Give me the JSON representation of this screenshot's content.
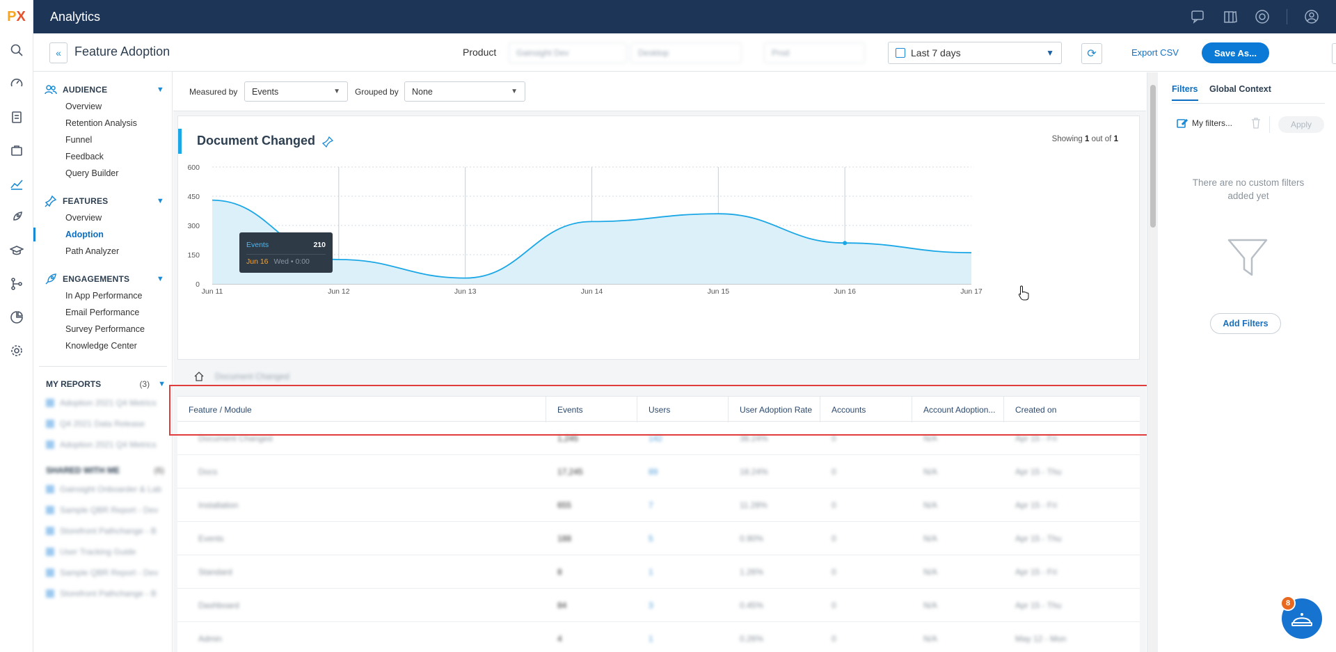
{
  "app": {
    "title": "Analytics",
    "logo": "PX"
  },
  "header": {
    "page_title": "Feature Adoption",
    "product_label": "Product",
    "product_selects": [
      "Gainsight Dev",
      "Desktop",
      "Prod"
    ],
    "date_range": "Last 7 days",
    "export_label": "Export CSV",
    "save_label": "Save As..."
  },
  "sidebar": {
    "sections": [
      {
        "title": "AUDIENCE",
        "icon": "users-icon",
        "items": [
          "Overview",
          "Retention Analysis",
          "Funnel",
          "Feedback",
          "Query Builder"
        ]
      },
      {
        "title": "FEATURES",
        "icon": "pin-icon",
        "items": [
          "Overview",
          "Adoption",
          "Path Analyzer"
        ],
        "active": "Adoption"
      },
      {
        "title": "ENGAGEMENTS",
        "icon": "rocket-icon",
        "items": [
          "In App Performance",
          "Email Performance",
          "Survey Performance",
          "Knowledge Center"
        ]
      }
    ],
    "my_reports": {
      "title": "MY REPORTS",
      "count": "(3)",
      "items": [
        "Adoption 2021 Q4 Metrics",
        "Q4 2021 Data Release",
        "Adoption 2021 Q4 Metrics"
      ]
    },
    "shared": {
      "title": "SHARED WITH ME",
      "count": "(6)",
      "items": [
        "Gainsight Onboarder & Lab",
        "Sample QBR Report - Dev",
        "Storefront Pathchange - B",
        "User Tracking Guide",
        "Sample QBR Report - Dev",
        "Storefront Pathchange - B"
      ]
    }
  },
  "controls": {
    "measured_label": "Measured by",
    "measured_value": "Events",
    "grouped_label": "Grouped by",
    "grouped_value": "None"
  },
  "chart_card": {
    "title": "Document Changed",
    "showing_prefix": "Showing",
    "showing_current": "1",
    "showing_middle": "out of",
    "showing_total": "1"
  },
  "chart_data": {
    "type": "area",
    "title": "Document Changed",
    "categories": [
      "Jun 11",
      "Jun 12",
      "Jun 13",
      "Jun 14",
      "Jun 15",
      "Jun 16",
      "Jun 17"
    ],
    "series": [
      {
        "values": [
          430,
          125,
          30,
          320,
          360,
          210,
          160
        ]
      }
    ],
    "y_ticks": [
      0,
      150,
      300,
      450,
      600
    ],
    "ylim": [
      0,
      600
    ],
    "grid": true,
    "color": "#1ba7e6"
  },
  "tooltip": {
    "label": "Events",
    "value": "210",
    "date": "Jun 16",
    "time": "Wed • 0:00"
  },
  "breadcrumb": {
    "current": "Document Changed"
  },
  "table": {
    "columns": [
      "Feature / Module",
      "Events",
      "Users",
      "User Adoption Rate",
      "Accounts",
      "Account Adoption...",
      "Created on"
    ],
    "rows": [
      [
        "Document Changed",
        "1,245",
        "142",
        "38.24%",
        "0",
        "N/A",
        "Apr 15 - Fri"
      ],
      [
        "Docs",
        "17,245",
        "89",
        "18.24%",
        "0",
        "N/A",
        "Apr 15 - Thu"
      ],
      [
        "Installation",
        "655",
        "7",
        "11.28%",
        "0",
        "N/A",
        "Apr 15 - Fri"
      ],
      [
        "Events",
        "188",
        "5",
        "0.90%",
        "0",
        "N/A",
        "Apr 15 - Thu"
      ],
      [
        "Standard",
        "8",
        "1",
        "1.26%",
        "0",
        "N/A",
        "Apr 15 - Fri"
      ],
      [
        "Dashboard",
        "84",
        "3",
        "0.45%",
        "0",
        "N/A",
        "Apr 15 - Thu"
      ],
      [
        "Admin",
        "4",
        "1",
        "0.26%",
        "0",
        "N/A",
        "May 12 - Mon"
      ]
    ]
  },
  "right_panel": {
    "tabs": [
      "Filters",
      "Global Context"
    ],
    "my_filters": "My filters...",
    "apply_label": "Apply",
    "empty_text": "There are no custom filters added yet",
    "add_label": "Add Filters"
  },
  "help": {
    "badge": "8"
  }
}
